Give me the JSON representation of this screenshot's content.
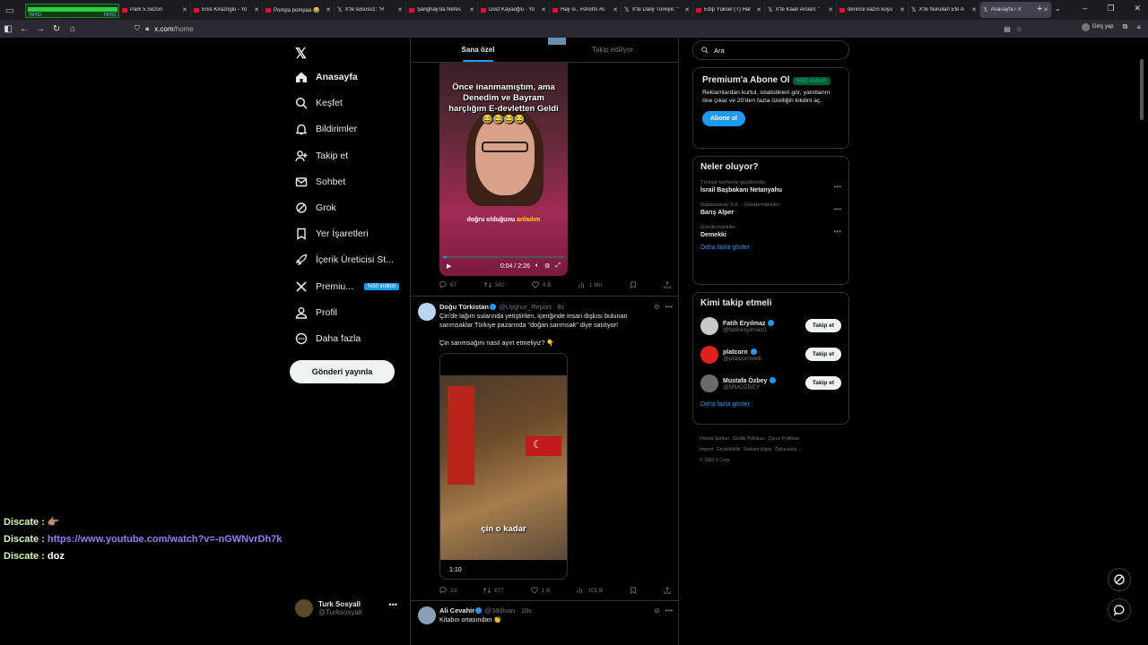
{
  "browser": {
    "stream_widget_line1": "TRYO",
    "stream_widget_line2": "TRYO",
    "tabs": [
      {
        "title": "Park 5.Sezon",
        "icon": "youtube-icon"
      },
      {
        "title": "Enis Kirazoglu - Yo",
        "icon": "youtube-icon"
      },
      {
        "title": "Pompa pompaa 😂",
        "icon": "youtube-icon"
      },
      {
        "title": "X'te ѕαѕυѕυz: \"R",
        "icon": "x-icon"
      },
      {
        "title": "Şanghay'da Nefes",
        "icon": "youtube-icon"
      },
      {
        "title": "Dost Kayaoğlu - Yo",
        "icon": "youtube-icon"
      },
      {
        "title": "Hay si.. #shorts #c",
        "icon": "youtube-icon"
      },
      {
        "title": "X'te Daily Türkiye: \"",
        "icon": "x-icon"
      },
      {
        "title": "Edip Yüksel (T) Hal",
        "icon": "youtube-icon"
      },
      {
        "title": "X'te Kaan Arslan: \"",
        "icon": "x-icon"
      },
      {
        "title": "derince kazın kuyu",
        "icon": "youtube-icon"
      },
      {
        "title": "X'te Nurullah Efe A",
        "icon": "x-icon"
      },
      {
        "title": "Anasayfa / X",
        "icon": "x-icon",
        "active": true
      }
    ],
    "url_domain": "x.com",
    "url_path": "/home",
    "signin_label": "Giriş yap"
  },
  "leftnav": {
    "items": [
      {
        "label": "Anasayfa",
        "icon": "home-icon"
      },
      {
        "label": "Keşfet",
        "icon": "search-icon"
      },
      {
        "label": "Bildirimler",
        "icon": "bell-icon"
      },
      {
        "label": "Takip et",
        "icon": "person-add-icon"
      },
      {
        "label": "Sohbet",
        "icon": "mail-icon"
      },
      {
        "label": "Grok",
        "icon": "grok-icon"
      },
      {
        "label": "Yer İşaretleri",
        "icon": "bookmark-icon"
      },
      {
        "label": "İçerik Üreticisi St...",
        "icon": "rocket-icon"
      },
      {
        "label": "Premiu...",
        "icon": "x-premium-icon",
        "badge": "%50 indirim"
      },
      {
        "label": "Profil",
        "icon": "profile-icon"
      },
      {
        "label": "Daha fazla",
        "icon": "more-circle-icon"
      }
    ],
    "post_button": "Gönderi yayınla",
    "account": {
      "name": "Turk Sosyall",
      "handle": "@Turksosyall"
    }
  },
  "feed": {
    "tabs": [
      "Sana özel",
      "Takip ediliyor"
    ],
    "post1": {
      "caption": "Önce inanmamıştım,  ama Denedim ve Bayram harçlığım E-devletten Geldi😂😂😂😂",
      "subtitle_a": "doğru olduğunu",
      "subtitle_b": "anladım",
      "time": "0:04 / 2:26",
      "replies": "67",
      "reposts": "342",
      "likes": "4 B",
      "views": "1 Mn",
      "progress": 0.03
    },
    "post2": {
      "name": "Doğu Türkistan",
      "handle": "@Uyghur_Report",
      "time": "8s",
      "text1": "Çin'de lağım sularında yetiştirilen, içeriğinde insan dışkısı bulunan sarımsaklar Türkiye pazarında \"doğan sarımsak\" diye satılıyor!",
      "text2": "Çin sarımsağını nasıl ayırt etmeliyiz? 👇",
      "video_caption": "çin o kadar",
      "video_duration": "1:10",
      "replies": "33",
      "reposts": "677",
      "likes": "1 B",
      "views": "101 B"
    },
    "post3": {
      "name": "Ali Cevahir",
      "handle": "@38dlvan",
      "time": "10s",
      "text": "Kitabın ortasından 👏"
    }
  },
  "right": {
    "search_placeholder": "Ara",
    "premium": {
      "title": "Premium'a Abone Ol",
      "badge": "%50 indirim",
      "text": "Reklamlardan kurtul, istatistikleri gör, yanıtlarını öne çıkar ve 20'den fazla özelliğin kilidini aç.",
      "button": "Abone ol"
    },
    "trends": {
      "title": "Neler oluyor?",
      "items": [
        {
          "context": "Türkiye tarihinde gündemde",
          "topic": "İsrail Başbakanı Netanyahu"
        },
        {
          "context": "Galatasaray S.K. · Gündemdekiler",
          "topic": "Barış Alper"
        },
        {
          "context": "Gündemdekiler",
          "topic": "Demekki"
        }
      ],
      "more": "Daha fazla göster"
    },
    "who_to_follow": {
      "title": "Kimi takip etmeli",
      "items": [
        {
          "name": "Fatih Eryılmaz",
          "handle": "@fatiheryilmaz0",
          "button": "Takip et"
        },
        {
          "name": "platcorn",
          "handle": "@platcornweb",
          "button": "Takip et"
        },
        {
          "name": "Mustafa Özbey",
          "handle": "@MMOZBEY",
          "button": "Takip et"
        }
      ],
      "more": "Daha fazla göster"
    },
    "footer": [
      "Hizmet Şartları",
      "Gizlilik Politikası",
      "Çerez Politikası",
      "Imprint",
      "Erişilebilirlik",
      "Reklam bilgisi",
      "Daha fazla ...",
      "© 2026 X Corp."
    ]
  },
  "chat": [
    {
      "name": "Discate :",
      "msg": "👉🏽",
      "link": false
    },
    {
      "name": "Discate :",
      "msg": "https://www.youtube.com/watch?v=-nGWNvrDh7k",
      "link": true
    },
    {
      "name": "Discate :",
      "msg": "doz",
      "link": false
    }
  ],
  "colors": {
    "accent": "#1d9bf0",
    "bg": "#000000",
    "border": "#2f3336",
    "muted": "#71767b"
  }
}
